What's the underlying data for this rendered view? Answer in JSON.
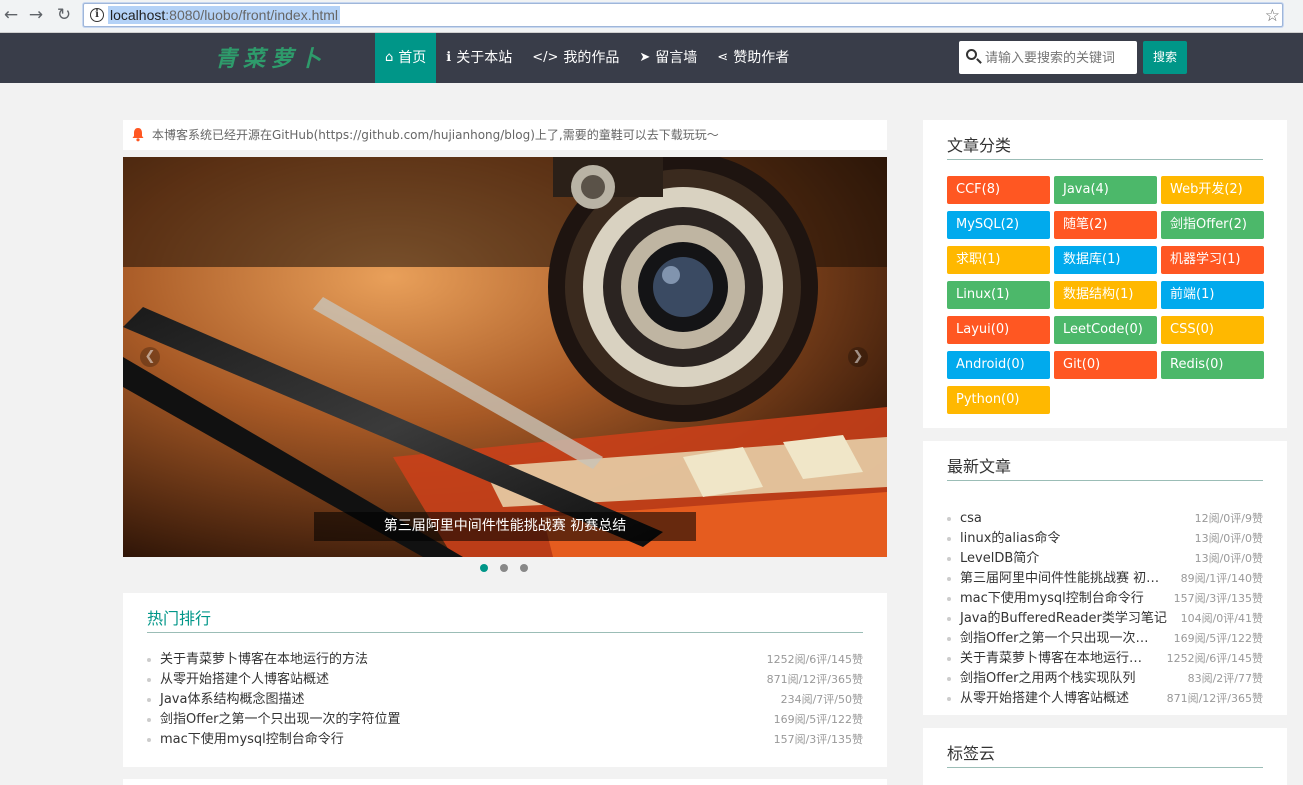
{
  "browser": {
    "url_host": "localhost",
    "url_rest": ":8080/luobo/front/index.html"
  },
  "nav": {
    "logo": "青菜萝卜",
    "menu": [
      {
        "label": "首页",
        "icon": "home-icon",
        "glyph": "⌂",
        "active": true
      },
      {
        "label": "关于本站",
        "icon": "info-icon",
        "glyph": "ℹ",
        "active": false
      },
      {
        "label": "我的作品",
        "icon": "code-icon",
        "glyph": "</>",
        "active": false
      },
      {
        "label": "留言墙",
        "icon": "paper-plane-icon",
        "glyph": "➤",
        "active": false
      },
      {
        "label": "赞助作者",
        "icon": "share-icon",
        "glyph": "⋖",
        "active": false
      }
    ],
    "search_placeholder": "请输入要搜索的关键词",
    "search_button": "搜索"
  },
  "notice": {
    "text": "本博客系统已经开源在GitHub(https://github.com/hujianhong/blog)上了,需要的童鞋可以去下载玩玩～"
  },
  "carousel": {
    "caption": "第三届阿里中间件性能挑战赛 初赛总结",
    "slide_count": 3,
    "active_slide": 0
  },
  "hot": {
    "title": "热门排行",
    "items": [
      {
        "title": "关于青菜萝卜博客在本地运行的方法",
        "meta": "1252阅/6评/145赞"
      },
      {
        "title": "从零开始搭建个人博客站概述",
        "meta": "871阅/12评/365赞"
      },
      {
        "title": "Java体系结构概念图描述",
        "meta": "234阅/7评/50赞"
      },
      {
        "title": "剑指Offer之第一个只出现一次的字符位置",
        "meta": "169阅/5评/122赞"
      },
      {
        "title": "mac下使用mysql控制台命令行",
        "meta": "157阅/3评/135赞"
      }
    ]
  },
  "categories": {
    "title": "文章分类",
    "colors": {
      "orange": "#ff5722",
      "green": "#4cb86a",
      "yellow": "#ffb800",
      "blue": "#01aaed"
    },
    "items": [
      {
        "label": "CCF(8)",
        "color": "#ff5722"
      },
      {
        "label": "Java(4)",
        "color": "#4cb86a"
      },
      {
        "label": "Web开发(2)",
        "color": "#ffb800"
      },
      {
        "label": "MySQL(2)",
        "color": "#01aaed"
      },
      {
        "label": "随笔(2)",
        "color": "#ff5722"
      },
      {
        "label": "剑指Offer(2)",
        "color": "#4cb86a"
      },
      {
        "label": "求职(1)",
        "color": "#ffb800"
      },
      {
        "label": "数据库(1)",
        "color": "#01aaed"
      },
      {
        "label": "机器学习(1)",
        "color": "#ff5722"
      },
      {
        "label": "Linux(1)",
        "color": "#4cb86a"
      },
      {
        "label": "数据结构(1)",
        "color": "#ffb800"
      },
      {
        "label": "前端(1)",
        "color": "#01aaed"
      },
      {
        "label": "Layui(0)",
        "color": "#ff5722"
      },
      {
        "label": "LeetCode(0)",
        "color": "#4cb86a"
      },
      {
        "label": "CSS(0)",
        "color": "#ffb800"
      },
      {
        "label": "Android(0)",
        "color": "#01aaed"
      },
      {
        "label": "Git(0)",
        "color": "#ff5722"
      },
      {
        "label": "Redis(0)",
        "color": "#4cb86a"
      },
      {
        "label": "Python(0)",
        "color": "#ffb800"
      }
    ]
  },
  "latest": {
    "title": "最新文章",
    "items": [
      {
        "title": "csa",
        "meta": "12阅/0评/9赞"
      },
      {
        "title": "linux的alias命令",
        "meta": "13阅/0评/0赞"
      },
      {
        "title": "LevelDB简介",
        "meta": "13阅/0评/0赞"
      },
      {
        "title": "第三届阿里中间件性能挑战赛 初…",
        "meta": "89阅/1评/140赞"
      },
      {
        "title": "mac下使用mysql控制台命令行",
        "meta": "157阅/3评/135赞"
      },
      {
        "title": "Java的BufferedReader类学习笔记",
        "meta": "104阅/0评/41赞"
      },
      {
        "title": "剑指Offer之第一个只出现一次…",
        "meta": "169阅/5评/122赞"
      },
      {
        "title": "关于青菜萝卜博客在本地运行…",
        "meta": "1252阅/6评/145赞"
      },
      {
        "title": "剑指Offer之用两个栈实现队列",
        "meta": "83阅/2评/77赞"
      },
      {
        "title": "从零开始搭建个人博客站概述",
        "meta": "871阅/12评/365赞"
      }
    ]
  },
  "tags": {
    "title": "标签云"
  }
}
